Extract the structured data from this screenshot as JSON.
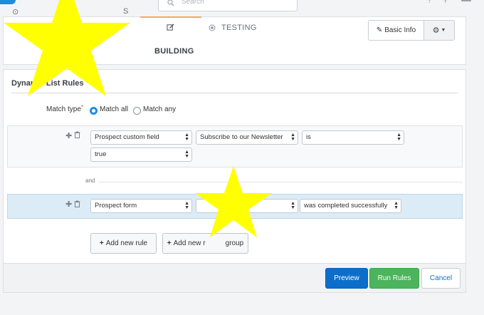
{
  "search": {
    "placeholder": "Search"
  },
  "steps": {
    "prev_partial": "S",
    "building": "BUILDING",
    "testing": "TESTING"
  },
  "toolbar": {
    "basic_info": "Basic Info"
  },
  "rules": {
    "title": "Dynamic List Rules",
    "match_type_label": "Match type",
    "match_all": "Match all",
    "match_any": "Match any",
    "row1": {
      "field": "Prospect custom field",
      "value_field": "Subscribe to our Newsletter",
      "operator": "is",
      "value": "true"
    },
    "connector": "and",
    "row2": {
      "field": "Prospect form",
      "value_field": "",
      "operator": "was completed successfully"
    },
    "add_rule": "Add new rule",
    "add_group_partial_left": "Add new r",
    "add_group_partial_right": "group"
  },
  "footer": {
    "preview": "Preview",
    "run_rules": "Run Rules",
    "cancel": "Cancel"
  },
  "colors": {
    "accent_blue": "#0b6ecb",
    "run_green": "#4bb45c",
    "active_step": "#f5a95e",
    "highlight_row": "#dcecf7",
    "overlay_star": "#ffff00"
  },
  "icons": [
    "search-icon",
    "plus-icon",
    "bell-icon",
    "edit-icon",
    "target-icon",
    "pencil-icon",
    "gear-icon",
    "caret-down-icon",
    "trash-icon",
    "star-overlay"
  ]
}
